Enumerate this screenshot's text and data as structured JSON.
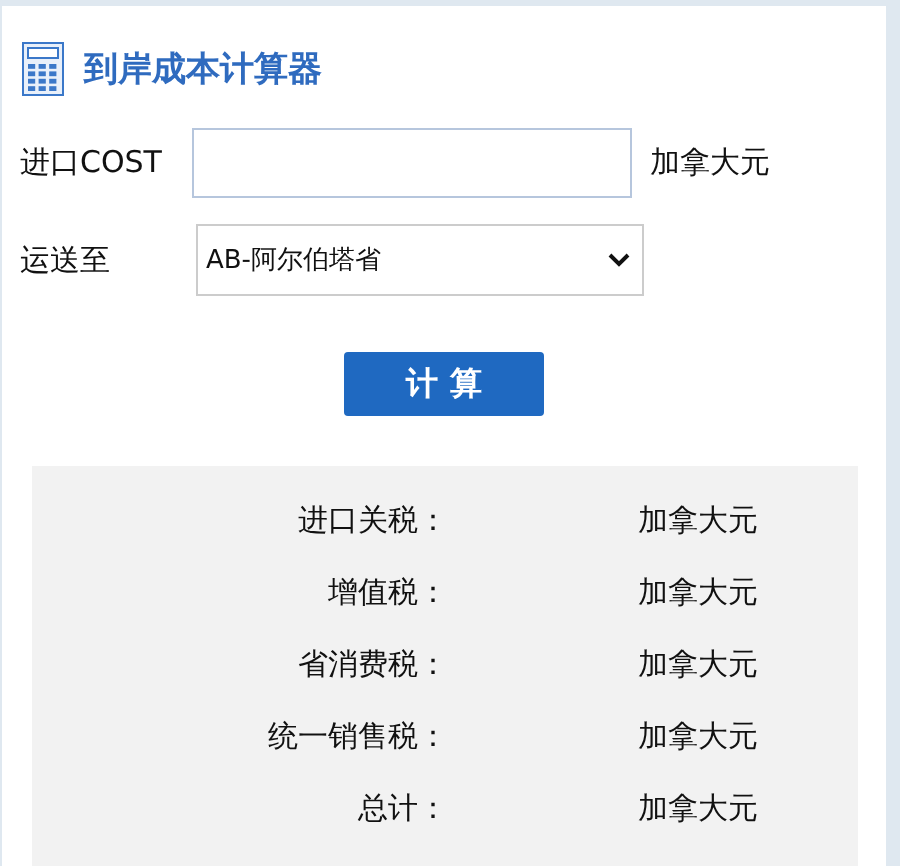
{
  "title": "到岸成本计算器",
  "cost_field": {
    "label": "进口COST",
    "unit": "加拿大元"
  },
  "destination": {
    "label": "运送至",
    "value": "AB-阿尔伯塔省"
  },
  "calculate_button": "计 算",
  "results": [
    {
      "label": "进口关税：",
      "value": "加拿大元"
    },
    {
      "label": "增值税：",
      "value": "加拿大元"
    },
    {
      "label": "省消费税：",
      "value": "加拿大元"
    },
    {
      "label": "统一销售税：",
      "value": "加拿大元"
    },
    {
      "label": "总计：",
      "value": "加拿大元"
    }
  ]
}
